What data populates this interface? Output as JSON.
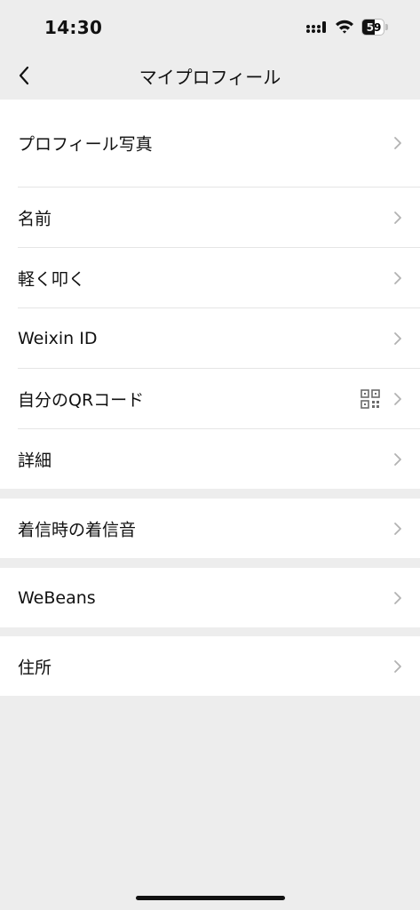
{
  "status_bar": {
    "time": "14:30",
    "battery_level": "59",
    "battery_fraction": 0.59
  },
  "nav": {
    "title": "マイプロフィール",
    "back_icon": "chevron-left-icon"
  },
  "groups": [
    {
      "items": [
        {
          "label": "プロフィール写真"
        },
        {
          "label": "名前"
        },
        {
          "label": "軽く叩く"
        },
        {
          "label": "Weixin ID"
        },
        {
          "label": "自分のQRコード",
          "icon": "qr-code-icon"
        },
        {
          "label": "詳細"
        }
      ]
    },
    {
      "items": [
        {
          "label": "着信時の着信音"
        }
      ]
    },
    {
      "items": [
        {
          "label": "WeBeans"
        }
      ]
    },
    {
      "items": [
        {
          "label": "住所"
        }
      ]
    }
  ],
  "colors": {
    "background": "#ededed",
    "cell": "#ffffff",
    "divider": "#e5e5e5",
    "chevron": "#b2b2b2",
    "text": "#111111"
  }
}
